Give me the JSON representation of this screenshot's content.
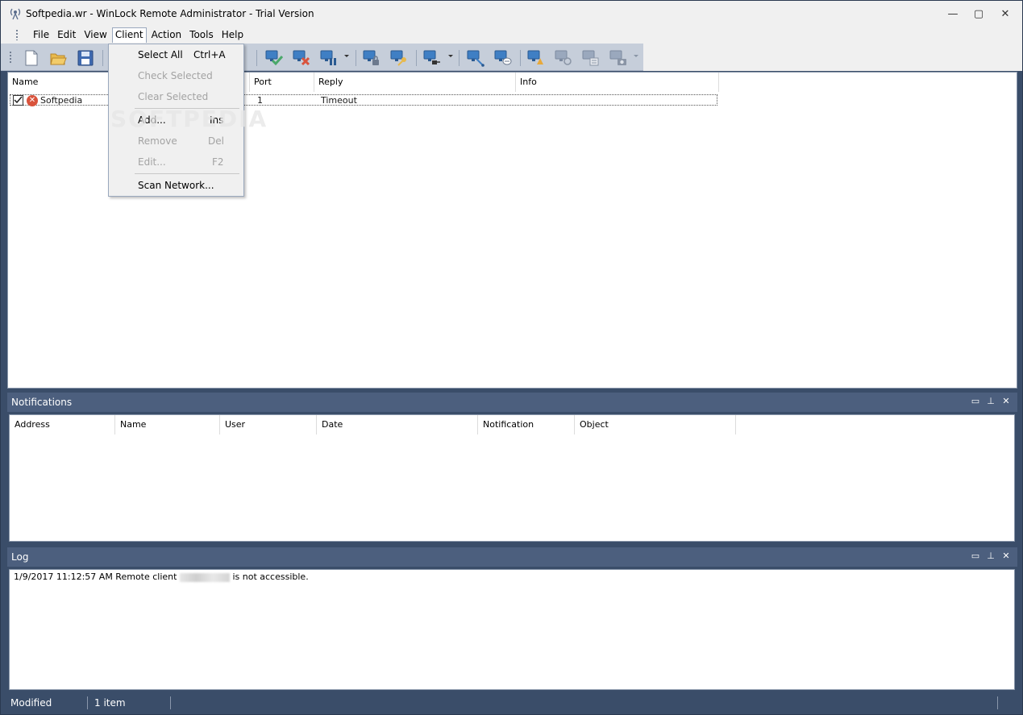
{
  "window": {
    "title": "Softpedia.wr - WinLock Remote Administrator - Trial Version",
    "minimize": "—",
    "maximize": "▢",
    "close": "✕"
  },
  "menubar": {
    "items": [
      "File",
      "Edit",
      "View",
      "Client",
      "Action",
      "Tools",
      "Help"
    ],
    "open_menu": "Client"
  },
  "client_menu": {
    "items": [
      {
        "label": "Select All",
        "shortcut": "Ctrl+A",
        "enabled": true
      },
      {
        "label": "Check Selected",
        "shortcut": "",
        "enabled": false
      },
      {
        "label": "Clear Selected",
        "shortcut": "",
        "enabled": false
      },
      {
        "label": "Add...",
        "shortcut": "Ins",
        "enabled": true
      },
      {
        "label": "Remove",
        "shortcut": "Del",
        "enabled": false
      },
      {
        "label": "Edit...",
        "shortcut": "F2",
        "enabled": false
      },
      {
        "label": "Scan Network...",
        "shortcut": "",
        "enabled": true
      }
    ]
  },
  "toolbar": {
    "buttons": [
      "new-icon",
      "open-icon",
      "save-icon",
      "check-client-icon",
      "stop-client-icon",
      "pause-client-icon",
      "lock-client-icon",
      "key-client-icon",
      "plug-client-icon",
      "connect-icon",
      "message-icon",
      "alert-icon",
      "shutdown-icon",
      "tasks-icon",
      "screenshot-icon"
    ]
  },
  "client_list": {
    "columns": [
      "Name",
      "Port",
      "Reply",
      "Info"
    ],
    "rows": [
      {
        "name": "Softpedia",
        "port": "1",
        "reply": "Timeout",
        "info": "",
        "checked": true,
        "status": "error"
      }
    ]
  },
  "watermark": "SOFTPEDIA",
  "notifications": {
    "title": "Notifications",
    "columns": [
      "Address",
      "Name",
      "User",
      "Date",
      "Notification",
      "Object"
    ]
  },
  "log": {
    "title": "Log",
    "entries": [
      {
        "prefix": "1/9/2017 11:12:57 AM Remote client ",
        "suffix": " is not accessible."
      }
    ]
  },
  "statusbar": {
    "state": "Modified",
    "count": "1 item"
  },
  "colors": {
    "accent": "#4c5f7e",
    "frame": "#3a4d69",
    "toolbar": "#c6ceda"
  }
}
